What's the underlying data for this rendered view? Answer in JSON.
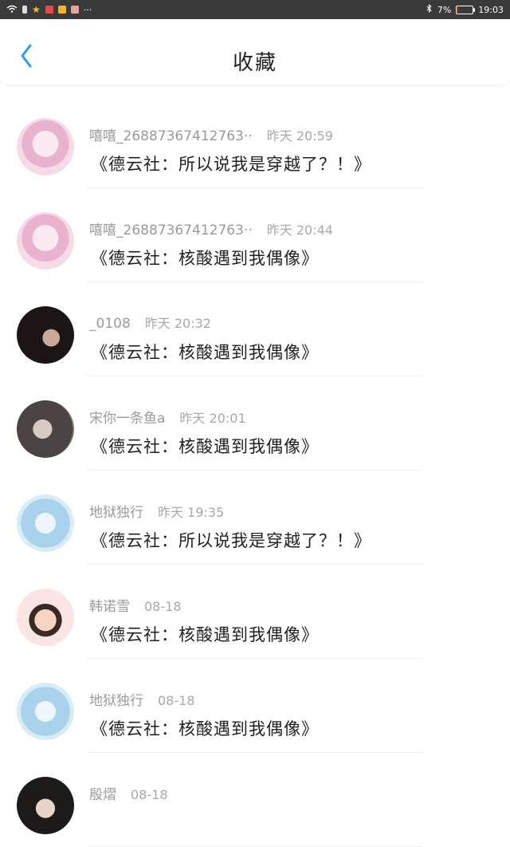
{
  "status_bar": {
    "battery_text": "7%",
    "time": "19:03",
    "battery_level_percent": 7,
    "more": "···"
  },
  "header": {
    "title": "收藏"
  },
  "items": [
    {
      "user": "嘻嘻_26887367412763··",
      "time": "昨天 20:59",
      "content": "《德云社：所以说我是穿越了？！》",
      "avatar": "anime-girl-pink"
    },
    {
      "user": "嘻嘻_26887367412763··",
      "time": "昨天 20:44",
      "content": "《德云社：核酸遇到我偶像》",
      "avatar": "anime-girl-pink"
    },
    {
      "user": "_0108",
      "time": "昨天 20:32",
      "content": "《德云社：核酸遇到我偶像》",
      "avatar": "dark-hair-girl"
    },
    {
      "user": "宋你一条鱼a",
      "time": "昨天 20:01",
      "content": "《德云社：核酸遇到我偶像》",
      "avatar": "girl-photo"
    },
    {
      "user": "地狱独行",
      "time": "昨天 19:35",
      "content": "《德云社：所以说我是穿越了？！》",
      "avatar": "anime-blue"
    },
    {
      "user": "韩诺雪",
      "time": "08-18",
      "content": "《德云社：核酸遇到我偶像》",
      "avatar": "bunny-boy"
    },
    {
      "user": "地狱独行",
      "time": "08-18",
      "content": "《德云社：核酸遇到我偶像》",
      "avatar": "anime-blue"
    },
    {
      "user": "殷熠",
      "time": "08-18",
      "content": "",
      "avatar": "girl-portrait"
    }
  ]
}
